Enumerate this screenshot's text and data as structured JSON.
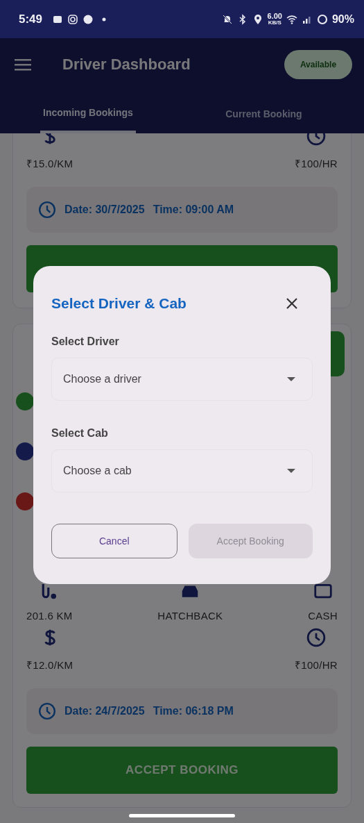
{
  "status_bar": {
    "time": "5:49",
    "network_speed": "6.00",
    "network_speed_unit": "KB/S",
    "battery": "90%"
  },
  "app_bar": {
    "title": "Driver Dashboard",
    "status_chip": "Available"
  },
  "tabs": [
    {
      "label": "Incoming Bookings",
      "selected": true
    },
    {
      "label": "Current Booking",
      "selected": false
    }
  ],
  "bookings": [
    {
      "rate_per_km": "₹15.0/KM",
      "rate_per_hr": "₹100/HR",
      "date": "Date: 30/7/2025",
      "time": "Time: 09:00 AM"
    },
    {
      "route_points": [
        {
          "color": "#174f1d"
        },
        {
          "color": "#141a49"
        },
        {
          "color": "#691717"
        }
      ],
      "stats": [
        "201.6 KM",
        "HATCHBACK",
        "CASH"
      ],
      "rate_per_km": "₹12.0/KM",
      "rate_per_hr": "₹100/HR",
      "date": "Date: 24/7/2025",
      "time": "Time: 06:18 PM",
      "accept_label": "ACCEPT BOOKING"
    }
  ],
  "dialog": {
    "title": "Select Driver & Cab",
    "fields": [
      {
        "label": "Select Driver",
        "placeholder": "Choose a driver"
      },
      {
        "label": "Select Cab",
        "placeholder": "Choose a cab"
      }
    ],
    "cancel_button": "Cancel",
    "accept_button": {
      "label": "Accept Booking",
      "disabled": true
    }
  }
}
